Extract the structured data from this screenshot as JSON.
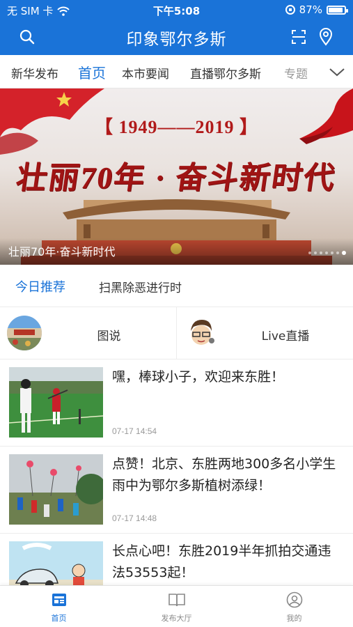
{
  "status_bar": {
    "carrier": "无 SIM 卡",
    "time": "下午5:08",
    "battery": "87%"
  },
  "header": {
    "title": "印象鄂尔多斯",
    "icons": [
      "search-icon",
      "scan-icon",
      "location-icon"
    ],
    "color": "#1a73d8"
  },
  "tabs": [
    {
      "label": "新华发布",
      "active": false
    },
    {
      "label": "首页",
      "active": true
    },
    {
      "label": "本市要闻",
      "active": false
    },
    {
      "label": "直播鄂尔多斯",
      "active": false
    },
    {
      "label": "专题",
      "active": false
    }
  ],
  "banner": {
    "years_text": "【 1949——2019 】",
    "slogan": "壮丽70年 · 奋斗新时代",
    "caption": "壮丽70年·奋斗新时代",
    "slide_count": 7,
    "active_slide": 7
  },
  "subtabs": [
    {
      "label": "今日推荐",
      "active": true
    },
    {
      "label": "扫黑除恶进行时",
      "active": false
    }
  ],
  "features": [
    {
      "label": "图说",
      "icon": "photo-thumbnail"
    },
    {
      "label": "Live直播",
      "icon": "cartoon-avatar"
    }
  ],
  "news": [
    {
      "headline": "嘿，棒球小子，欢迎来东胜！",
      "time": "07-17 14:54",
      "image": "baseball-kids-photo"
    },
    {
      "headline": "点赞！北京、东胜两地300多名小学生雨中为鄂尔多斯植树添绿！",
      "time": "07-17 14:48",
      "image": "tree-planting-photo"
    },
    {
      "headline": "长点心吧！东胜2019半年抓拍交通违法53553起！",
      "time": "",
      "image": "traffic-cartoon"
    }
  ],
  "bottom_nav": [
    {
      "label": "首页",
      "icon": "home-news-icon",
      "active": true
    },
    {
      "label": "发布大厅",
      "icon": "book-icon",
      "active": false
    },
    {
      "label": "我的",
      "icon": "profile-icon",
      "active": false
    }
  ]
}
